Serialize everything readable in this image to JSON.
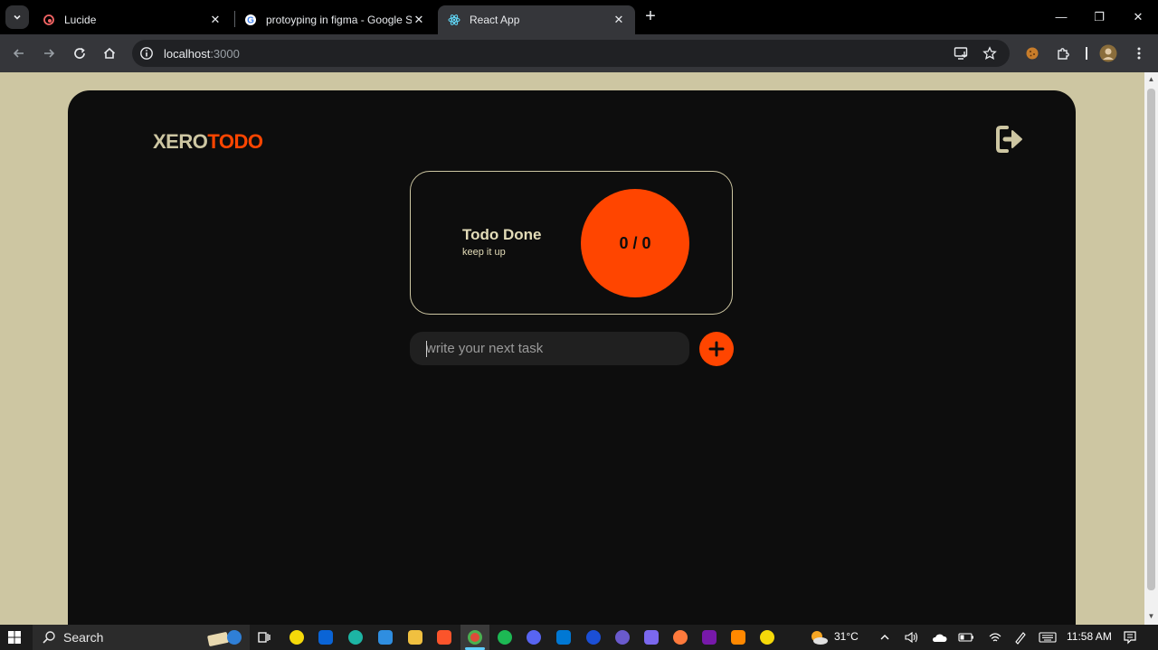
{
  "browser": {
    "tabs": [
      {
        "title": "Lucide",
        "active": false
      },
      {
        "title": "protoyping in figma - Google S",
        "active": false
      },
      {
        "title": "React App",
        "active": true
      }
    ],
    "url_host": "localhost",
    "url_port": ":3000"
  },
  "app": {
    "logo_part1": "XERO",
    "logo_part2": "TODO",
    "card_title": "Todo Done",
    "card_subtitle": "keep it up",
    "progress_text": "0 / 0",
    "input_placeholder": "write your next task",
    "colors": {
      "accent": "#ff4500",
      "beige": "#cdc6a2",
      "panel": "#0d0d0d"
    }
  },
  "taskbar": {
    "search_label": "Search",
    "temperature": "31°C",
    "time": "11:58 AM"
  }
}
